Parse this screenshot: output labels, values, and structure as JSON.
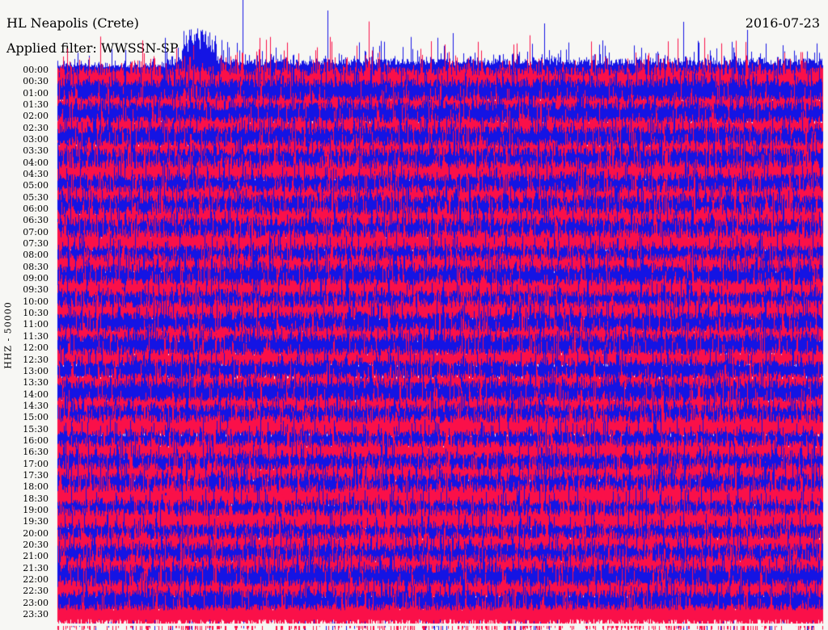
{
  "header": {
    "station_title": "HL Neapolis (Crete)",
    "filter_label": "Applied filter: WWSSN-SP",
    "date": "2016-07-23"
  },
  "y_axis": {
    "scale_label": "HHZ - 50000",
    "time_labels": [
      "00:00",
      "00:30",
      "01:00",
      "01:30",
      "02:00",
      "02:30",
      "03:00",
      "03:30",
      "04:00",
      "04:30",
      "05:00",
      "05:30",
      "06:00",
      "06:30",
      "07:00",
      "07:30",
      "08:00",
      "08:30",
      "09:00",
      "09:30",
      "10:00",
      "10:30",
      "11:00",
      "11:30",
      "12:00",
      "12:30",
      "13:00",
      "13:30",
      "14:00",
      "14:30",
      "15:00",
      "15:30",
      "16:00",
      "16:30",
      "17:00",
      "17:30",
      "18:00",
      "18:30",
      "19:00",
      "19:30",
      "20:00",
      "20:30",
      "21:00",
      "21:30",
      "22:00",
      "22:30",
      "23:00",
      "23:30"
    ]
  },
  "colors": {
    "red": "#fa1049",
    "blue": "#1414e4",
    "background": "#f7f7f4",
    "text": "#000000"
  },
  "chart_data": {
    "type": "line",
    "subtype": "helicorder-seismogram",
    "title": "HL Neapolis (Crete)",
    "date": "2016-07-23",
    "filter": "WWSSN-SP",
    "ylabel": "HHZ - 50000",
    "xlabel": "",
    "rows": 48,
    "minutes_per_row": 30,
    "row_times": [
      "00:00",
      "00:30",
      "01:00",
      "01:30",
      "02:00",
      "02:30",
      "03:00",
      "03:30",
      "04:00",
      "04:30",
      "05:00",
      "05:30",
      "06:00",
      "06:30",
      "07:00",
      "07:30",
      "08:00",
      "08:30",
      "09:00",
      "09:30",
      "10:00",
      "10:30",
      "11:00",
      "11:30",
      "12:00",
      "12:30",
      "13:00",
      "13:30",
      "14:00",
      "14:30",
      "15:00",
      "15:30",
      "16:00",
      "16:30",
      "17:00",
      "17:30",
      "18:00",
      "18:30",
      "19:00",
      "19:30",
      "20:00",
      "20:30",
      "21:00",
      "21:30",
      "22:00",
      "22:30",
      "23:00",
      "23:30"
    ],
    "trace_color_cycle": [
      "#1414e4",
      "#fa1049"
    ],
    "trace_color_rule": "even rows (00:00,01:00,...) blue, odd rows (00:30,01:30,...) red",
    "amplitude_note": "all 48 half-hour traces are clipped/saturated at full scale, overlapping adjacent rows; occasional large spikes cross multiple rows; first trace spikes extend into the header area",
    "legend": "none",
    "grid": "off"
  }
}
